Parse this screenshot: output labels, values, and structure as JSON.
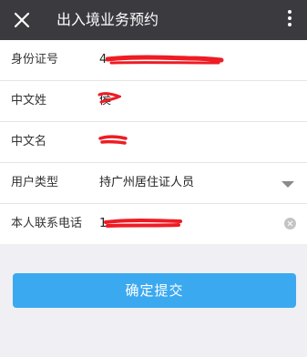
{
  "header": {
    "title": "出入境业务预约",
    "close_icon": "close-icon",
    "more_icon": "more-vertical-icon"
  },
  "form": {
    "id_number": {
      "label": "身份证号",
      "value": "4"
    },
    "surname": {
      "label": "中文姓",
      "value": "侯"
    },
    "given_name": {
      "label": "中文名",
      "value": ""
    },
    "user_type": {
      "label": "用户类型",
      "value": "持广州居住证人员"
    },
    "phone": {
      "label": "本人联系电话",
      "value": "1"
    }
  },
  "submit": {
    "label": "确定提交"
  },
  "colors": {
    "topbar": "#3a3a3f",
    "accent": "#3ba9f0",
    "redaction": "#ee1c24"
  }
}
